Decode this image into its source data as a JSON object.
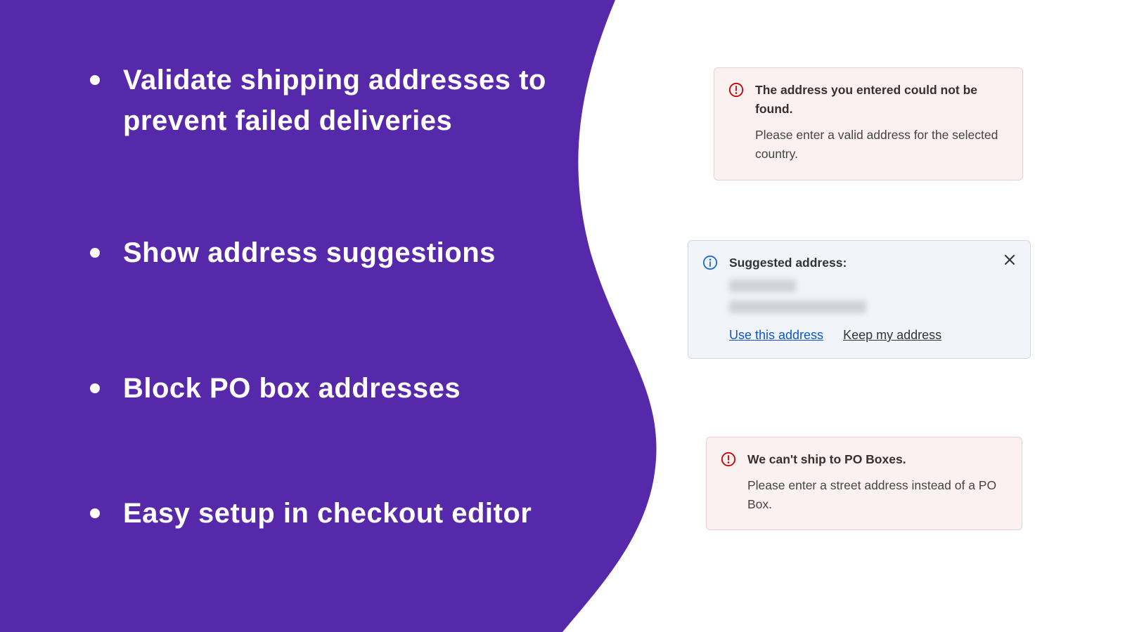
{
  "features": {
    "item1": "Validate shipping addresses to prevent failed deliveries",
    "item2": "Show address suggestions",
    "item3": "Block PO box addresses",
    "item4": "Easy setup in checkout editor"
  },
  "card_error_notfound": {
    "title": "The address you entered could not be found.",
    "body": "Please enter a valid address for the selected country."
  },
  "card_suggestion": {
    "title": "Suggested address:",
    "action_use": "Use this address",
    "action_keep": "Keep my address"
  },
  "card_error_pobox": {
    "title": "We can't ship to PO Boxes.",
    "body": "Please enter a street address instead of a PO Box."
  },
  "colors": {
    "purple": "#5529A9",
    "error_bg": "#FCF1F1",
    "info_bg": "#F1F5FA",
    "error_icon": "#CC0000",
    "info_icon": "#1C6DD0",
    "link_primary": "#1155CC"
  }
}
